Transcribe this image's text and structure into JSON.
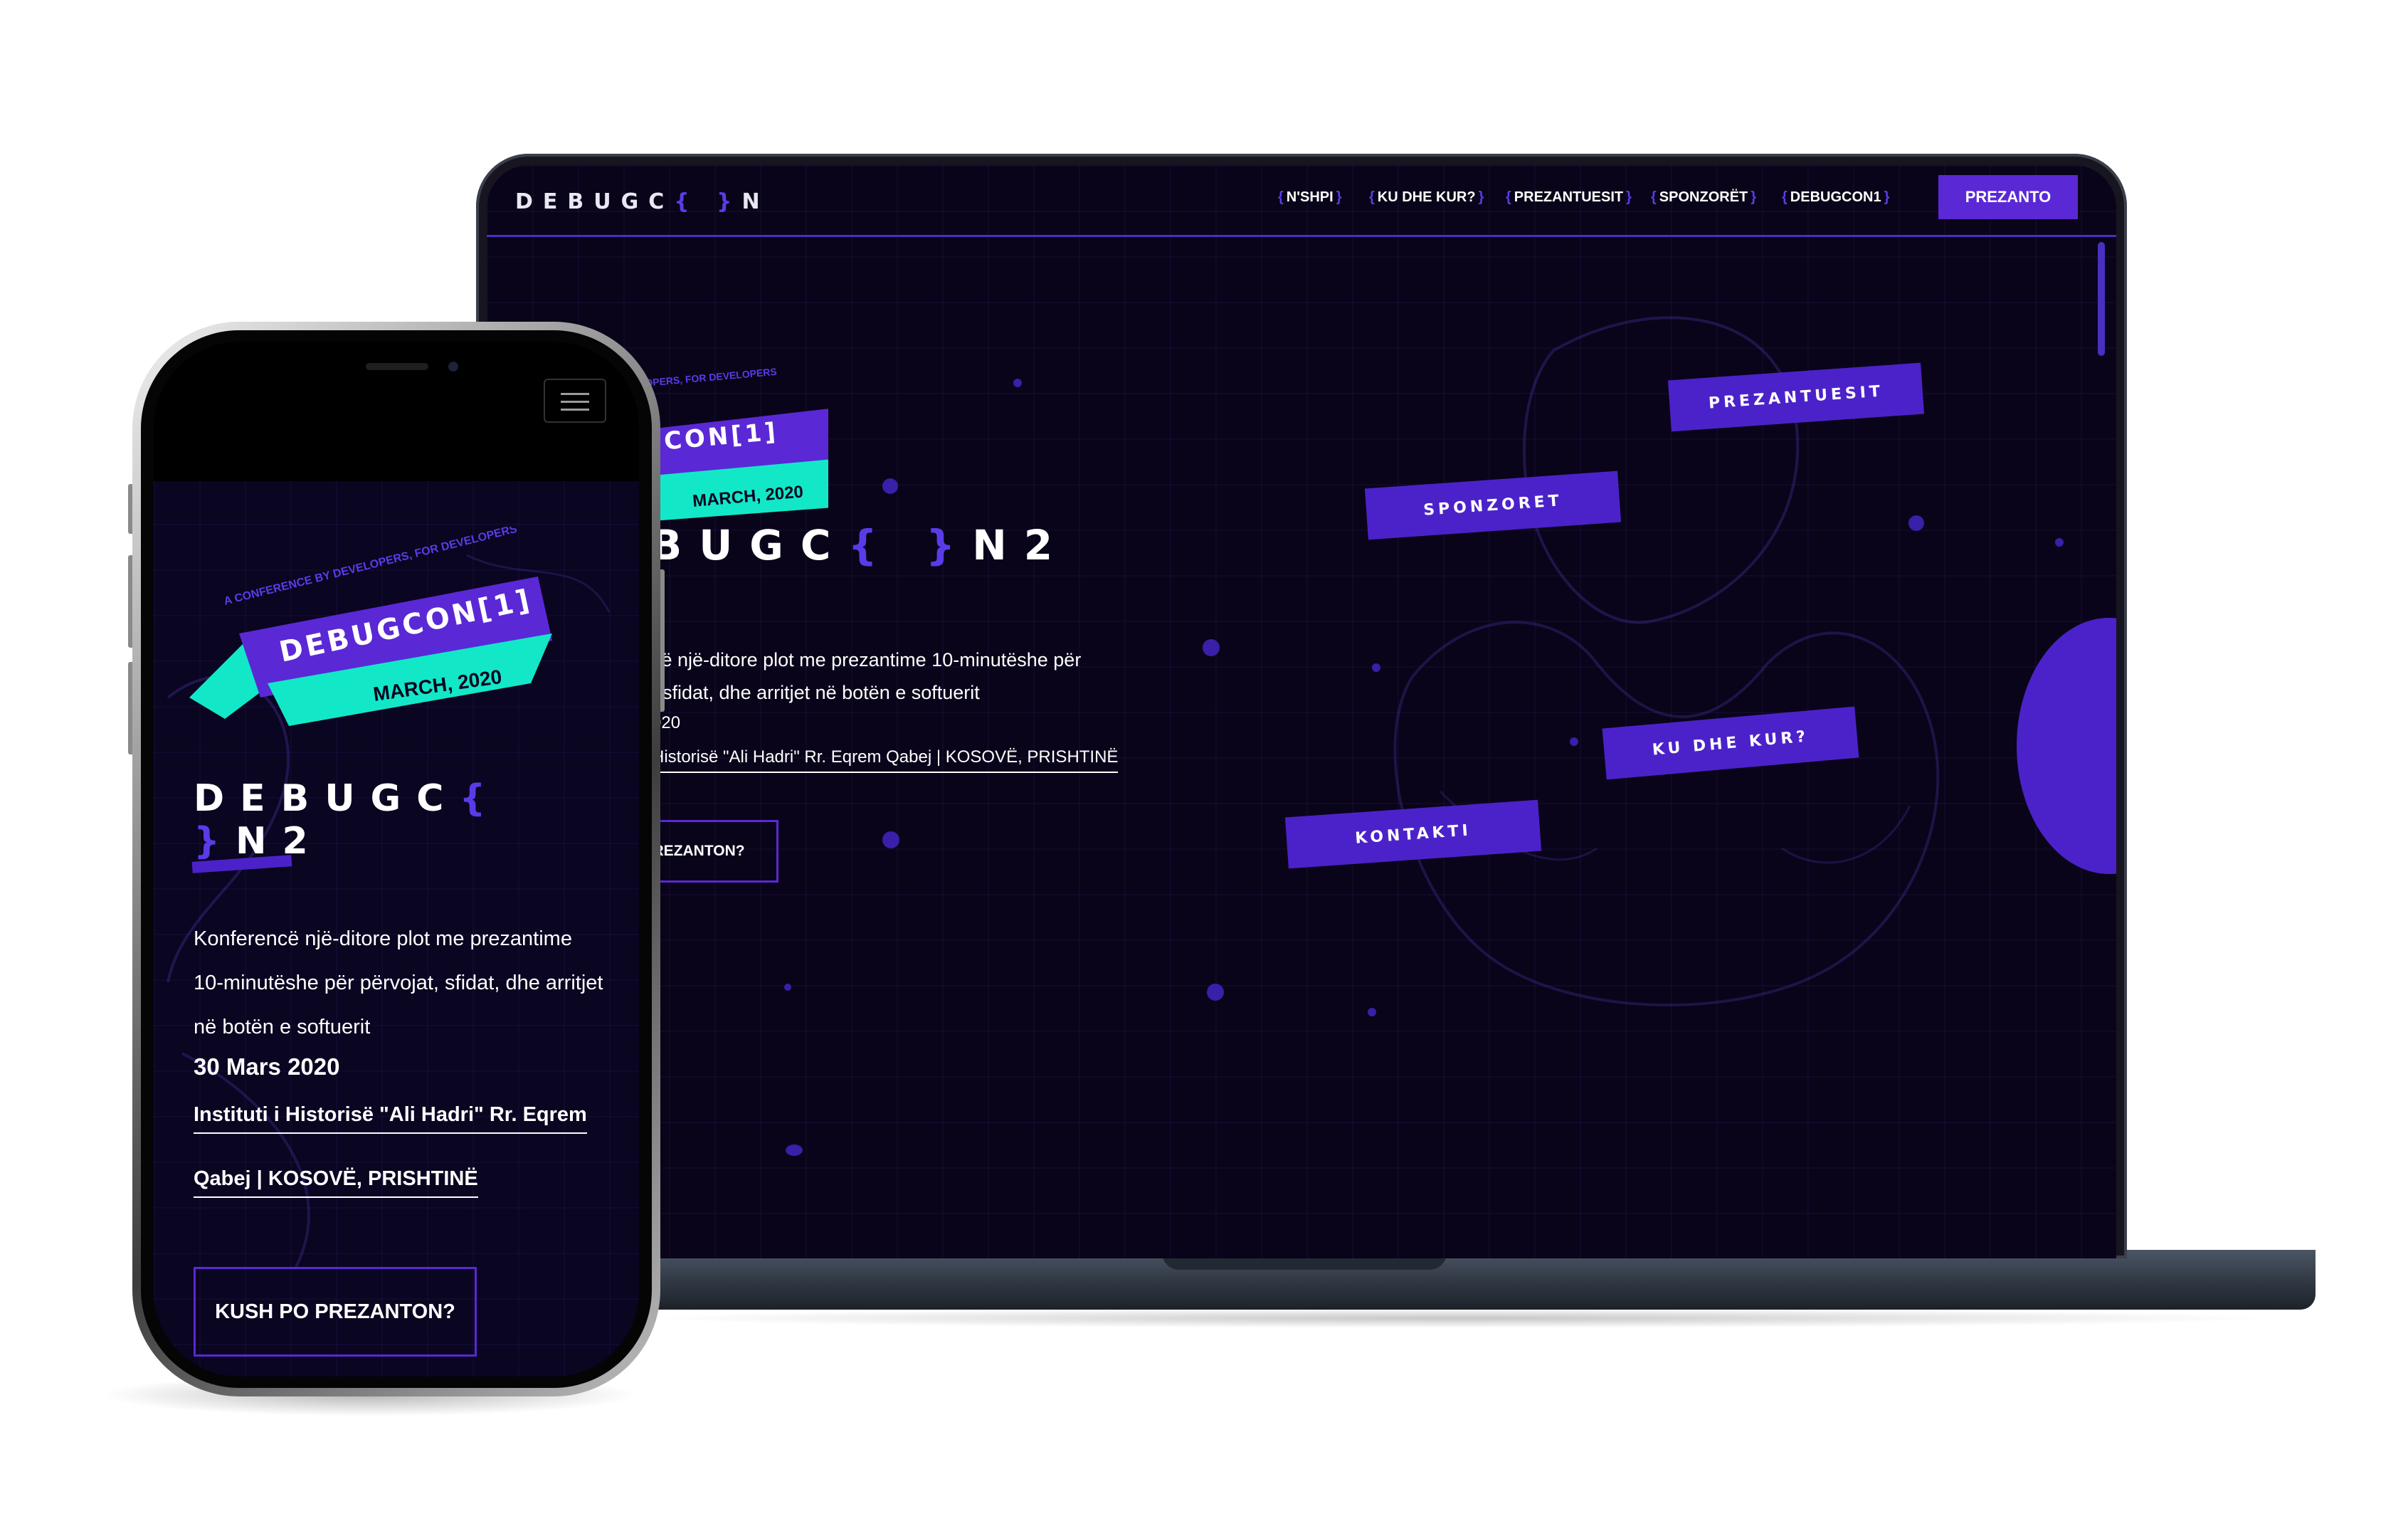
{
  "brand": {
    "logo_pre": "DEBUGC",
    "logo_brace": "{ }",
    "logo_post": "N",
    "accent": "#5b28d6",
    "teal": "#12e8c8",
    "background": "#090419"
  },
  "nav": {
    "items": [
      "N'SHPI",
      "KU DHE KUR?",
      "PREZANTUESIT",
      "SPONZORËT",
      "DEBUGCON1"
    ],
    "brace_open": "{",
    "brace_close": "}",
    "cta": "PREZANTO"
  },
  "hero": {
    "title_pre": "DEBUGC",
    "title_brace": "{ }",
    "title_post": "N2",
    "laptop_title_visible": "BUGC",
    "laptop_title_post": "N2",
    "description": "Konferencë një-ditore plot me prezantime 10-minutëshe për përvojat, sfidat, dhe arritjet në botën e softuerit",
    "laptop_desc_line1": "cë një-ditore plot me prezantime 10-minutëshe për",
    "laptop_desc_line2": ", sfidat, dhe arritjet në botën e softuerit",
    "laptop_date": "020",
    "laptop_location": "Historisë \"Ali Hadri\" Rr. Eqrem Qabej | KOSOVË, PRISHTINË",
    "laptop_button": "O PREZANTON?",
    "date": "30 Mars 2020",
    "location_line1": "Instituti i Historisë \"Ali Hadri\" Rr. Eqrem",
    "location_line2": "Qabej | KOSOVË, PRISHTINË",
    "button": "KUSH PO PREZANTON?"
  },
  "banner": {
    "tagline": "A CONFERENCE BY DEVELOPERS, FOR DEVELOPERS",
    "laptop_tagline": "NCE BY DEVELOPERS, FOR DEVELOPERS",
    "name": "DEBUGCON[1]",
    "laptop_name": "EBUGCON[1]",
    "date": "MARCH, 2020"
  },
  "tags": {
    "prezantuesit": "PREZANTUESIT",
    "sponzoret": "SPONZORET",
    "ku_dhe_kur": "KU DHE KUR?",
    "kontakti": "KONTAKTI"
  }
}
